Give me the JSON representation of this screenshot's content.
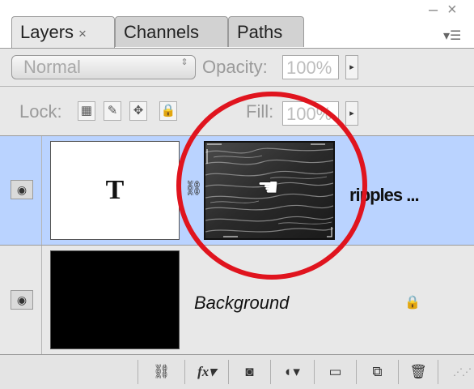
{
  "panel": {
    "window_controls": {
      "minimize": "–",
      "close": "×",
      "panel_menu": "▾☰"
    },
    "tabs": [
      {
        "label": "Layers",
        "close": "×",
        "active": true
      },
      {
        "label": "Channels",
        "active": false
      },
      {
        "label": "Paths",
        "active": false
      }
    ],
    "blend_mode": {
      "value": "Normal",
      "arrows": "⇕"
    },
    "opacity": {
      "label": "Opacity:",
      "value": "100%",
      "arrow": "▸"
    },
    "lock": {
      "label": "Lock:",
      "icons": [
        "lock-transparent-pixels-icon",
        "lock-image-pixels-icon",
        "lock-position-icon",
        "lock-all-icon"
      ],
      "glyphs": [
        "▦",
        "✎",
        "✥",
        "🔒"
      ]
    },
    "fill": {
      "label": "Fill:",
      "value": "100%",
      "arrow": "▸"
    }
  },
  "layers": [
    {
      "name": "ripples ...",
      "text_thumb": "T",
      "link": "⛓",
      "selected": true,
      "eye": "◉",
      "has_mask": true
    },
    {
      "name": "Background",
      "lock_glyph": "🔒",
      "selected": false,
      "eye": "◉"
    }
  ],
  "bottom_bar": {
    "buttons": [
      {
        "name": "link-layers-button",
        "glyph": "⛓"
      },
      {
        "name": "add-layer-style-button",
        "glyph": "fx▾"
      },
      {
        "name": "add-layer-mask-button",
        "glyph": "◙"
      },
      {
        "name": "new-adjustment-layer-button",
        "glyph": "◐▾"
      },
      {
        "name": "new-group-button",
        "glyph": "▭"
      },
      {
        "name": "new-layer-button",
        "glyph": "⧉"
      },
      {
        "name": "delete-layer-button",
        "glyph": "🗑"
      }
    ],
    "grip": "⋰⋰"
  },
  "colors": {
    "highlight": "#e0141e",
    "selected_row": "#bad3ff"
  }
}
